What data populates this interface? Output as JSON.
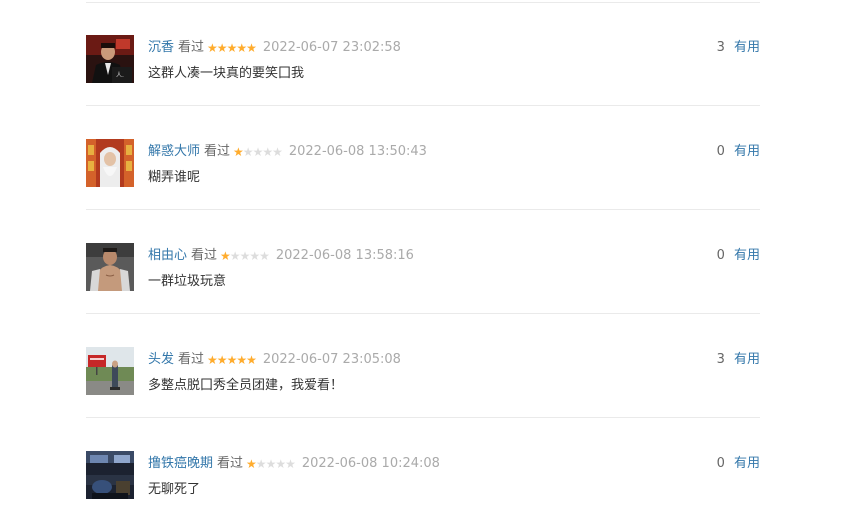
{
  "colors": {
    "username": "#3377aa",
    "star_on": "#ffac2d",
    "star_off": "#dddddd",
    "time": "#aaaaaa",
    "text": "#333333",
    "divider": "#eaeaea"
  },
  "comments": [
    {
      "username": "沉香",
      "status": "看过",
      "rating": 5,
      "time": "2022-06-07 23:02:58",
      "text": "这群人凑一块真的要笑囗我",
      "votes": "3",
      "useful_label": "有用",
      "avatar_icon": "avatar-man-in-suit-icon"
    },
    {
      "username": "解惑大师",
      "status": "看过",
      "rating": 1,
      "time": "2022-06-08 13:50:43",
      "text": "糊弄谁呢",
      "votes": "0",
      "useful_label": "有用",
      "avatar_icon": "avatar-white-haired-figure-icon"
    },
    {
      "username": "相由心",
      "status": "看过",
      "rating": 1,
      "time": "2022-06-08 13:58:16",
      "text": "一群垃圾玩意",
      "votes": "0",
      "useful_label": "有用",
      "avatar_icon": "avatar-shirtless-man-icon"
    },
    {
      "username": "头发",
      "status": "看过",
      "rating": 5,
      "time": "2022-06-07 23:05:08",
      "text": "多整点脱囗秀全员团建，我爱看！",
      "votes": "3",
      "useful_label": "有用",
      "avatar_icon": "avatar-billboard-road-icon"
    },
    {
      "username": "撸铁癌晚期",
      "status": "看过",
      "rating": 1,
      "time": "2022-06-08 10:24:08",
      "text": "无聊死了",
      "votes": "0",
      "useful_label": "有用",
      "avatar_icon": "avatar-car-interior-icon"
    }
  ]
}
